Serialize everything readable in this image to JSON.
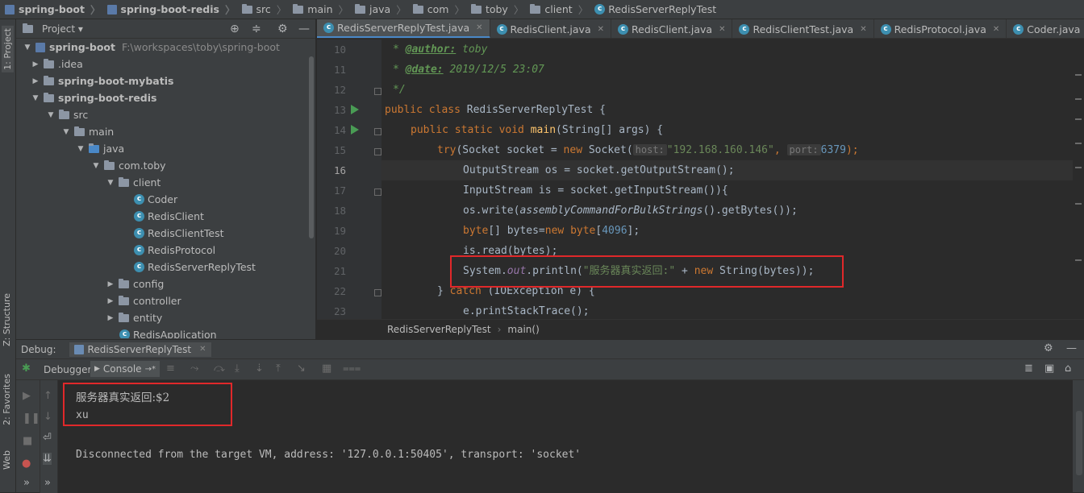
{
  "breadcrumb": [
    "spring-boot",
    "spring-boot-redis",
    "src",
    "main",
    "java",
    "com",
    "toby",
    "client",
    "RedisServerReplyTest"
  ],
  "left_strip": {
    "project": "1: Project",
    "structure": "Z: Structure",
    "favorites": "2: Favorites",
    "web": "Web"
  },
  "project_panel": {
    "title": "Project",
    "items": [
      {
        "label": "spring-boot",
        "path": "F:\\workspaces\\toby\\spring-boot"
      },
      {
        "label": ".idea"
      },
      {
        "label": "spring-boot-mybatis"
      },
      {
        "label": "spring-boot-redis"
      },
      {
        "label": "src"
      },
      {
        "label": "main"
      },
      {
        "label": "java"
      },
      {
        "label": "com.toby"
      },
      {
        "label": "client"
      },
      {
        "label": "Coder"
      },
      {
        "label": "RedisClient"
      },
      {
        "label": "RedisClientTest"
      },
      {
        "label": "RedisProtocol"
      },
      {
        "label": "RedisServerReplyTest"
      },
      {
        "label": "config"
      },
      {
        "label": "controller"
      },
      {
        "label": "entity"
      },
      {
        "label": "RedisApplication"
      }
    ]
  },
  "editor_tabs": [
    "RedisServerReplyTest.java",
    "RedisClient.java",
    "RedisClient.java",
    "RedisClientTest.java",
    "RedisProtocol.java",
    "Coder.java"
  ],
  "code": {
    "line_numbers": [
      "10",
      "11",
      "12",
      "13",
      "14",
      "15",
      "16",
      "17",
      "18",
      "19",
      "20",
      "21",
      "22",
      "23"
    ],
    "l10_tag": "@author:",
    "l10_val": "toby",
    "l11_tag": "@date:",
    "l11_val": "2019/12/5 23:07",
    "l12": "*/",
    "l13_kw": "public class ",
    "l13_name": "RedisServerReplyTest {",
    "l14_kw": "public static void ",
    "l14_meth": "main",
    "l14_rest": "(String[] args) {",
    "l15_a": "try",
    "l15_b": "(Socket socket = ",
    "l15_new": "new ",
    "l15_c": "Socket(",
    "l15_hint1": "host:",
    "l15_str": "\"192.168.160.146\"",
    "l15_comma": ",",
    "l15_hint2": "port:",
    "l15_num": "6379",
    "l15_end": ");",
    "l16": "OutputStream os = socket.getOutputStream();",
    "l17": "InputStream is = socket.getInputStream()){",
    "l18_a": "os.write(",
    "l18_b": "assemblyCommandForBulkStrings",
    "l18_c": "().getBytes());",
    "l19_kw": "byte",
    "l19_a": "[] bytes=",
    "l19_new": "new ",
    "l19_kw2": "byte",
    "l19_b": "[",
    "l19_num": "4096",
    "l19_c": "];",
    "l20": "is.read(bytes);",
    "l21_a": "System.",
    "l21_out": "out",
    "l21_b": ".println(",
    "l21_str": "\"服务器真实返回:\"",
    "l21_c": " + ",
    "l21_new": "new ",
    "l21_d": "String(bytes));",
    "l22_a": "} ",
    "l22_kw": "catch ",
    "l22_b": "(IOException e) {",
    "l23": "e.printStackTrace();"
  },
  "editor_breadcrumb": {
    "cls": "RedisServerReplyTest",
    "method": "main()"
  },
  "debug": {
    "label": "Debug:",
    "session": "RedisServerReplyTest",
    "tab_debugger": "Debugger",
    "tab_console": "Console",
    "console_lines": [
      "服务器真实返回:$2",
      "xu",
      "Disconnected from the target VM, address: '127.0.0.1:50405', transport: 'socket'"
    ]
  },
  "colors": {
    "accent": "#4a88c7",
    "highlight_box": "#e0282a",
    "run_marker": "#499c54"
  }
}
